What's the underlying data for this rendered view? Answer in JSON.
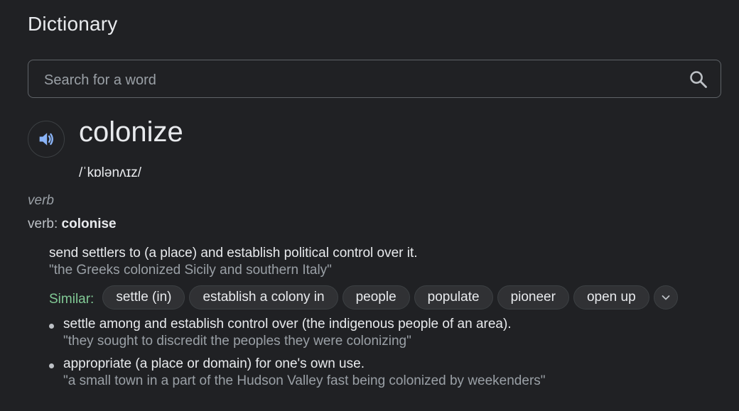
{
  "header": {
    "title": "Dictionary"
  },
  "search": {
    "placeholder": "Search for a word",
    "value": ""
  },
  "entry": {
    "word": "colonize",
    "phonetic": "/ˈkɒlənʌɪz/",
    "part_of_speech": "verb",
    "variant_label": "verb",
    "variant_sep": ": ",
    "variant_word": "colonise",
    "definition": "send settlers to (a place) and establish political control over it.",
    "example": "\"the Greeks colonized Sicily and southern Italy\"",
    "similar_label": "Similar:",
    "similar": [
      "settle (in)",
      "establish a colony in",
      "people",
      "populate",
      "pioneer",
      "open up"
    ],
    "subsenses": [
      {
        "definition": "settle among and establish control over (the indigenous people of an area).",
        "example": "\"they sought to discredit the peoples they were colonizing\""
      },
      {
        "definition": "appropriate (a place or domain) for one's own use.",
        "example": "\"a small town in a part of the Hudson Valley fast being colonized by weekenders\""
      }
    ]
  },
  "colors": {
    "background": "#202124",
    "accent_blue": "#8ab4f8",
    "similar_green": "#81c995"
  },
  "icons": {
    "search": "search-icon",
    "speaker": "speaker-icon",
    "expand": "chevron-down-icon"
  }
}
